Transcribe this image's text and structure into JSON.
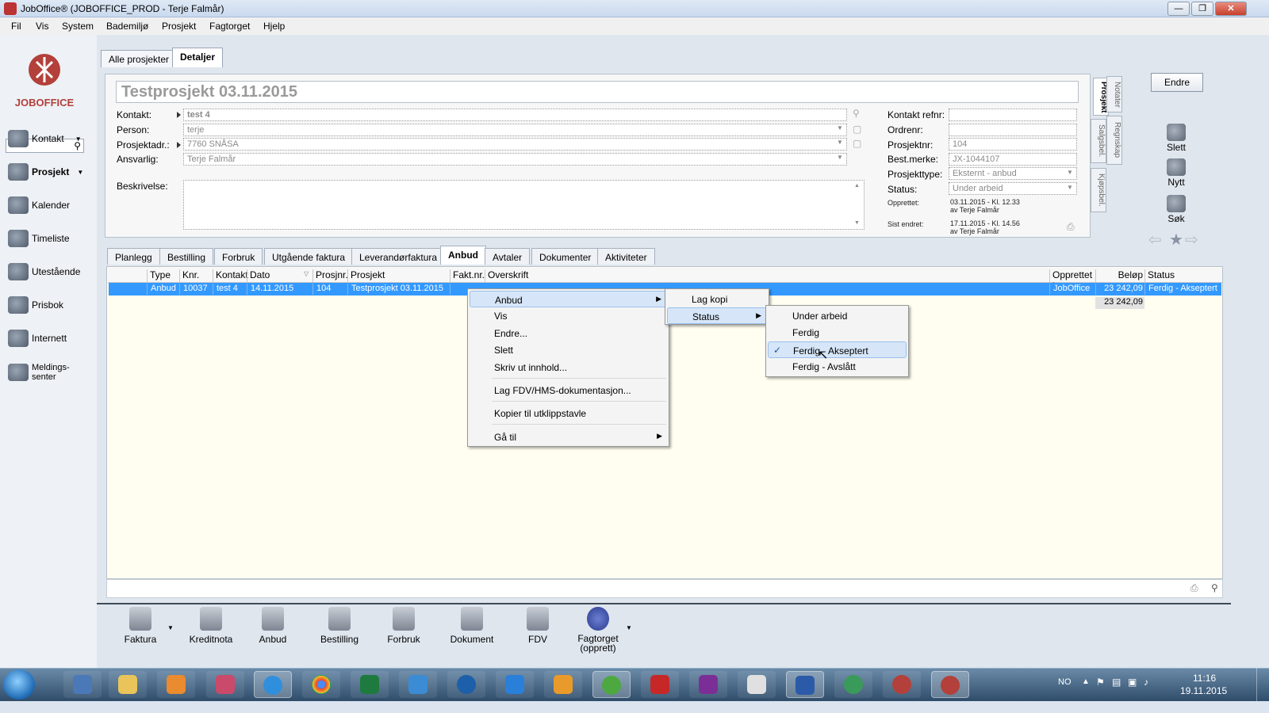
{
  "window": {
    "title": "JobOffice®   (JOBOFFICE_PROD - Terje Falmår)",
    "minimize": "—",
    "maximize": "❐",
    "close": "✕"
  },
  "menu": [
    "Fil",
    "Vis",
    "System",
    "Bademiljø",
    "Prosjekt",
    "Fagtorget",
    "Hjelp"
  ],
  "logo_text": "JOBOFFICE",
  "sidebar": [
    {
      "label": "Kontakt",
      "icon": "contacts-icon"
    },
    {
      "label": "Prosjekt",
      "icon": "project-icon"
    },
    {
      "label": "Kalender",
      "icon": "calendar-icon"
    },
    {
      "label": "Timeliste",
      "icon": "clock-icon"
    },
    {
      "label": "Utestående",
      "icon": "outstanding-icon"
    },
    {
      "label": "Prisbok",
      "icon": "pricebook-icon"
    },
    {
      "label": "Internett",
      "icon": "globe-icon"
    },
    {
      "label": "Meldings-\nsenter",
      "icon": "messages-icon"
    }
  ],
  "top_tabs": [
    "Alle prosjekter",
    "Detaljer"
  ],
  "project": {
    "title": "Testprosjekt 03.11.2015",
    "labels": {
      "kontakt": "Kontakt:",
      "person": "Person:",
      "prosjektadr": "Prosjektadr.:",
      "ansvarlig": "Ansvarlig:",
      "beskrivelse": "Beskrivelse:",
      "kontakt_refnr": "Kontakt refnr:",
      "ordrenr": "Ordrenr:",
      "prosjektnr": "Prosjektnr:",
      "best_merke": "Best.merke:",
      "prosjekttype": "Prosjekttype:",
      "status": "Status:",
      "opprettet": "Opprettet:",
      "sist_endret": "Sist endret:"
    },
    "kontakt": "test 4",
    "person": "terje",
    "prosjektadr": "7760 SNÅSA",
    "ansvarlig": "Terje Falmår",
    "beskrivelse": "",
    "kontakt_refnr": "",
    "ordrenr": "",
    "prosjektnr": "104",
    "best_merke": "JX-1044107",
    "prosjekttype": "Eksternt - anbud",
    "status": "Under arbeid",
    "opprettet_1": "03.11.2015 - Kl. 12.33",
    "opprettet_2": "av Terje Falmår",
    "sist_endret_1": "17.11.2015 - Kl. 14.56",
    "sist_endret_2": "av Terje Falmår"
  },
  "side_tabs": [
    "Prosjekt",
    "Notater",
    "Salgsbel.",
    "Regnskap",
    "Kjøpsbel."
  ],
  "actions": {
    "endre": "Endre",
    "slett": "Slett",
    "nytt": "Nytt",
    "sok": "Søk"
  },
  "sub_tabs": [
    "Planlegg",
    "Bestilling",
    "Forbruk",
    "Utgående faktura",
    "Leverandørfaktura",
    "Anbud",
    "Avtaler",
    "Dokumenter",
    "Aktiviteter"
  ],
  "grid": {
    "columns": [
      "Type",
      "Knr.",
      "Kontakt",
      "Dato",
      "Prosjnr.",
      "Prosjekt",
      "Fakt.nr.",
      "Overskrift",
      "Opprettet i",
      "Beløp",
      "Status"
    ],
    "row": [
      "Anbud",
      "10037",
      "test 4",
      "14.11.2015",
      "104",
      "Testprosjekt 03.11.2015",
      "",
      "",
      "JobOffice",
      "23 242,09",
      "Ferdig - Akseptert"
    ],
    "sum": "23 242,09"
  },
  "context_menu": {
    "main": [
      "Anbud",
      "Vis",
      "Endre...",
      "Slett",
      "Skriv ut innhold...",
      "Lag FDV/HMS-dokumentasjon...",
      "Kopier til utklippstavle",
      "Gå til"
    ],
    "anbud_sub": [
      "Lag kopi",
      "Status"
    ],
    "status_sub": [
      "Under arbeid",
      "Ferdig",
      "Ferdig - Akseptert",
      "Ferdig - Avslått"
    ],
    "checked": "Ferdig - Akseptert"
  },
  "bottom_bar": [
    "Faktura",
    "Kreditnota",
    "Anbud",
    "Bestilling",
    "Forbruk",
    "Dokument",
    "FDV",
    "Fagtorget\n(opprett)"
  ],
  "taskbar": {
    "lang": "NO",
    "time": "11:16",
    "date": "19.11.2015"
  },
  "colors": {
    "selection": "#3399ff",
    "grid_bg": "#fffef0",
    "accent": "#1c68b4"
  }
}
